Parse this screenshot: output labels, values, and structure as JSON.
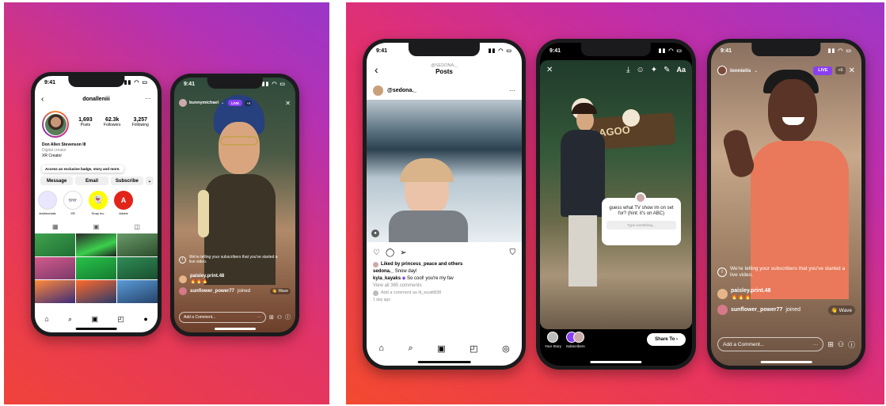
{
  "colors": {
    "live": "#8a3ff2",
    "link": "#0095f6"
  },
  "left_panel": {
    "profile_phone": {
      "time": "9:41",
      "username": "donalleniii",
      "stats": [
        {
          "value": "1,693",
          "label": "Posts"
        },
        {
          "value": "62.3k",
          "label": "Followers"
        },
        {
          "value": "3,257",
          "label": "Following"
        }
      ],
      "full_name": "Don Allen Stevenson III",
      "category": "Digital creator",
      "bio": "XR Creator",
      "tooltip": "Access an exclusive badge, story and more.",
      "buttons": [
        "Message",
        "Email",
        "Subscribe"
      ],
      "highlights": [
        "testimonials",
        "XR",
        "Snap Inc.",
        "Adobe"
      ]
    },
    "live_phone": {
      "time": "9:41",
      "host": "bunnymichael",
      "live_label": "LIVE",
      "viewers": "+6",
      "notice": "We're telling your subscribers that you've started a live video.",
      "comments": [
        {
          "user": "paisley.print.48",
          "text": "🔥🔥🔥"
        },
        {
          "user": "sunflower_power77",
          "text": "joined"
        }
      ],
      "wave": "Wave",
      "comment_placeholder": "Add a Comment..."
    }
  },
  "right_panel": {
    "post_phone": {
      "time": "9:41",
      "header_sub": "@SEDONA._",
      "header_title": "Posts",
      "post_user": "@sedona._",
      "liked_by": "Liked by princess_peace and others",
      "caption_user": "sedona._",
      "caption_text": "Snow day!",
      "comment_user": "kyia_kayaks",
      "comment_text": "So cool! you're my fav",
      "view_all": "View all 365 comments",
      "add_comment": "Add a comment as lil_wyatt838",
      "time_ago": "1 day ago"
    },
    "story_phone": {
      "time": "9:41",
      "text_tool": "Aa",
      "question": "guess what TV show im on set for? (hint: it's on ABC)",
      "answer_placeholder": "Type something...",
      "sign": "LAGOO",
      "your_story": "Your Story",
      "subscribers": "Subscribers",
      "share": "Share To"
    },
    "live_phone": {
      "time": "9:41",
      "host": "lonnielis",
      "live_label": "LIVE",
      "viewers": "+6",
      "notice": "We're telling your subscribers that you've started a live video.",
      "comments": [
        {
          "user": "paisley.print.48",
          "text": "🔥🔥🔥"
        },
        {
          "user": "sunflower_power77",
          "text": "joined"
        }
      ],
      "wave": "Wave",
      "comment_placeholder": "Add a Comment..."
    }
  }
}
